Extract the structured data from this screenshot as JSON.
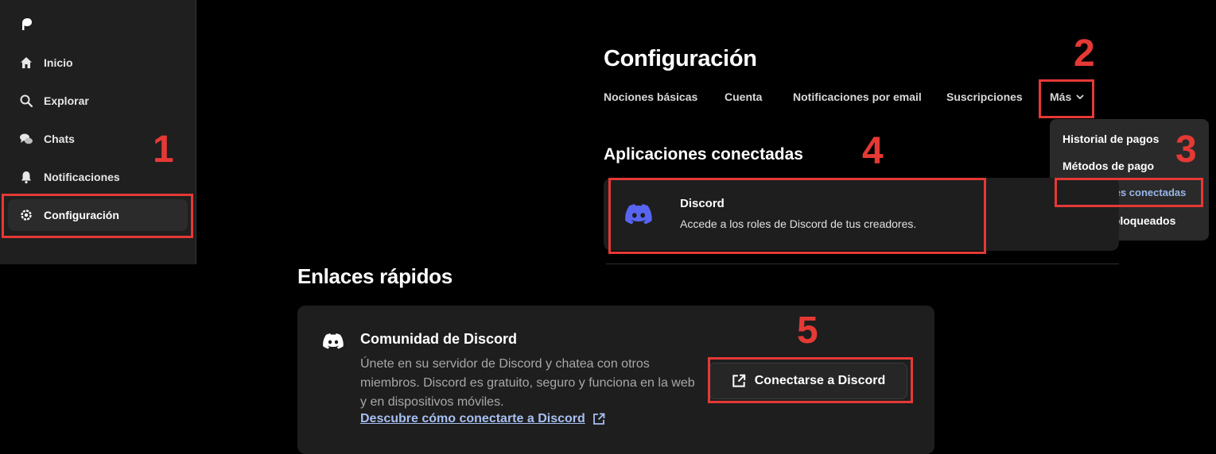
{
  "sidebar": {
    "items": [
      {
        "label": "Inicio",
        "icon": "home-icon"
      },
      {
        "label": "Explorar",
        "icon": "search-icon"
      },
      {
        "label": "Chats",
        "icon": "chat-icon"
      },
      {
        "label": "Notificaciones",
        "icon": "bell-icon"
      },
      {
        "label": "Configuración",
        "icon": "gear-icon",
        "active": true
      }
    ]
  },
  "header": {
    "title": "Configuración",
    "tabs": [
      "Nociones básicas",
      "Cuenta",
      "Notificaciones por email",
      "Suscripciones",
      "Más"
    ]
  },
  "dropdown": {
    "items": [
      "Historial de pagos",
      "Métodos de pago",
      "Aplicaciones conectadas",
      "Usuarios bloqueados"
    ],
    "active_index": 2
  },
  "connected_apps": {
    "title": "Aplicaciones conectadas",
    "discord": {
      "name": "Discord",
      "description": "Accede a los roles de Discord de tus creadores."
    }
  },
  "quick_links": {
    "title": "Enlaces rápidos",
    "community": {
      "title": "Comunidad de Discord",
      "description": "Únete en su servidor de Discord y chatea con otros miembros. Discord es gratuito, seguro y funciona en la web y en dispositivos móviles.",
      "link": "Descubre cómo conectarte a Discord",
      "button": "Conectarse a Discord"
    }
  },
  "annotations": [
    "1",
    "2",
    "3",
    "4",
    "5"
  ],
  "colors": {
    "annotation": "#e53935",
    "discord_blurple": "#5865f2",
    "link": "#a7bff0",
    "active_menu": "#9bb5e9"
  }
}
